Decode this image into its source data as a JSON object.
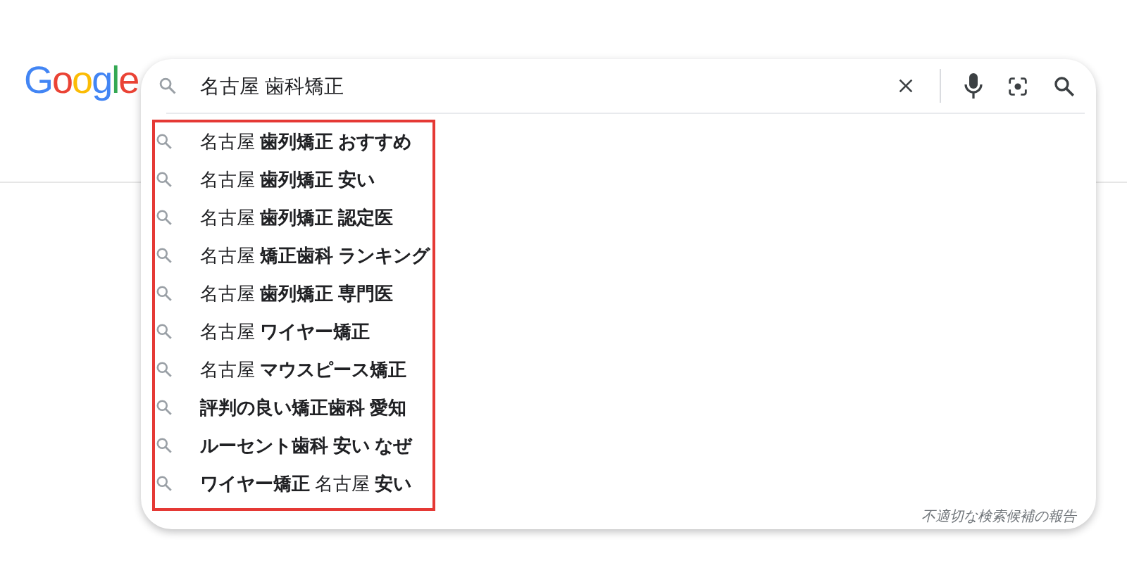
{
  "logo": "Google",
  "search": {
    "value": "名古屋 歯科矯正"
  },
  "suggestions": [
    {
      "text": "名古屋 **歯列矯正 おすすめ**"
    },
    {
      "text": "名古屋 **歯列矯正 安い**"
    },
    {
      "text": "名古屋 **歯列矯正 認定医**"
    },
    {
      "text": "名古屋 **矯正歯科 ランキング**"
    },
    {
      "text": "名古屋 **歯列矯正 専門医**"
    },
    {
      "text": "名古屋 **ワイヤー矯正**"
    },
    {
      "text": "名古屋 **マウスピース矯正**"
    },
    {
      "text": "**評判の良い矯正歯科 愛知**"
    },
    {
      "text": "**ルーセント歯科 安い なぜ**"
    },
    {
      "text": "**ワイヤー矯正** 名古屋 **安い**"
    }
  ],
  "report_link": "不適切な検索候補の報告"
}
